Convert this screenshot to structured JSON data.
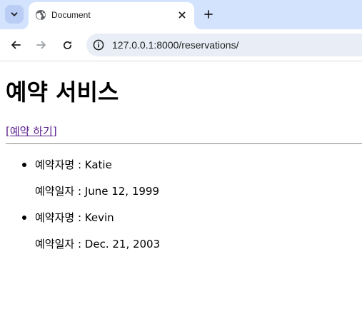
{
  "browser": {
    "tab": {
      "title": "Document",
      "favicon": "globe-icon",
      "close_icon": "close-icon"
    },
    "tab_menu_icon": "chevron-down-icon",
    "new_tab_icon": "plus-icon",
    "toolbar": {
      "back_icon": "arrow-left-icon",
      "forward_icon": "arrow-right-icon",
      "reload_icon": "reload-icon",
      "site_info_icon": "info-icon",
      "url": "127.0.0.1:8000/reservations/"
    }
  },
  "page": {
    "title": "예약 서비스",
    "reserve_link": "[예약 하기]",
    "reservations": [
      {
        "name_line": "예약자명 : Katie",
        "date_line": "예약일자 : June 12, 1999"
      },
      {
        "name_line": "예약자명 : Kevin",
        "date_line": "예약일자 : Dec. 21, 2003"
      }
    ]
  },
  "colors": {
    "tabstrip_bg": "#d3e3fd",
    "omnibox_bg": "#e9eef6",
    "visited_link": "#551a8b",
    "divider": "#8a8a8a"
  }
}
